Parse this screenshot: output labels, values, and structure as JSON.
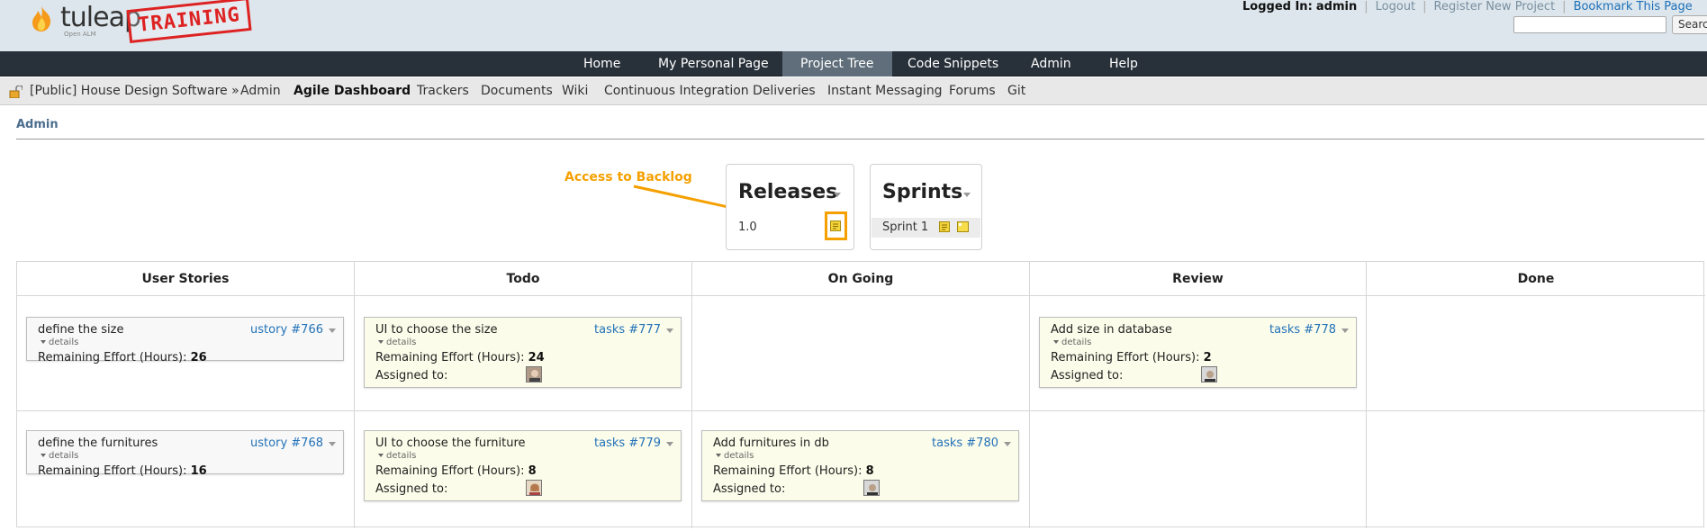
{
  "header": {
    "brand": "tuleap",
    "tagline": "Open ALM",
    "stamp": "TRAINING",
    "logged_in_label": "Logged In:",
    "logged_in_user": "admin",
    "links": [
      "Logout",
      "Register New Project",
      "Bookmark This Page"
    ],
    "search_button": "Search",
    "search_placeholder": ""
  },
  "main_nav": {
    "items": [
      "Home",
      "My Personal Page",
      "Project Tree",
      "Code Snippets",
      "Admin",
      "Help"
    ],
    "active": "Project Tree"
  },
  "project_nav": {
    "items": [
      "[Public] House Design Software »",
      "Admin",
      "Agile Dashboard",
      "Trackers",
      "Documents",
      "Wiki",
      "Continuous Integration",
      "Deliveries",
      "Instant Messaging",
      "Forums",
      "Git"
    ],
    "active": "Agile Dashboard"
  },
  "admin_link": "Admin",
  "annotation": "Access to Backlog",
  "releases": {
    "title": "Releases",
    "items": [
      "1.0"
    ]
  },
  "sprints": {
    "title": "Sprints",
    "items": [
      "Sprint 1"
    ]
  },
  "board": {
    "columns": [
      "User Stories",
      "Todo",
      "On Going",
      "Review",
      "Done"
    ],
    "effort_label": "Remaining Effort (Hours):",
    "assigned_label": "Assigned to:",
    "details_label": "details",
    "rows": [
      {
        "story": {
          "title": "define the size",
          "ref": "ustory #766",
          "effort": "26"
        },
        "tasks": [
          {
            "column": "Todo",
            "title": "UI to choose the size",
            "ref": "tasks #777",
            "effort": "24"
          },
          {
            "column": "Review",
            "title": "Add size in database",
            "ref": "tasks #778",
            "effort": "2"
          }
        ]
      },
      {
        "story": {
          "title": "define the furnitures",
          "ref": "ustory #768",
          "effort": "16"
        },
        "tasks": [
          {
            "column": "Todo",
            "title": "UI to choose the furniture",
            "ref": "tasks #779",
            "effort": "8"
          },
          {
            "column": "On Going",
            "title": "Add furnitures in db",
            "ref": "tasks #780",
            "effort": "8"
          }
        ]
      }
    ]
  },
  "colors": {
    "header_bg": "#dce6ec",
    "nav_bg": "#283039",
    "nav_active": "#5f6e7a",
    "annotation": "#f5a000",
    "link": "#2272b8",
    "task_card": "#fcfcea",
    "story_card": "#f8f8f8"
  }
}
